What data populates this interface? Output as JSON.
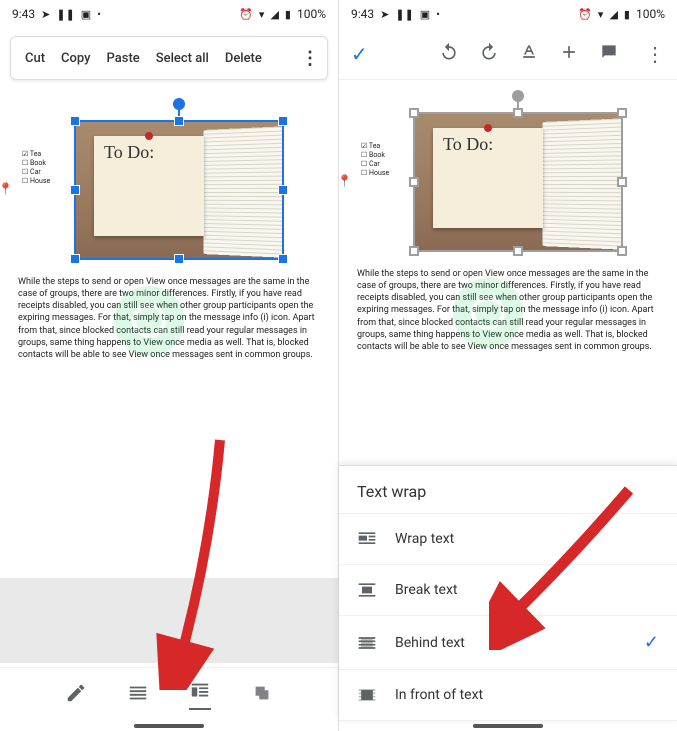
{
  "status": {
    "time": "9:43",
    "battery": "100%",
    "icons_left": [
      "send",
      "pause",
      "image",
      "dot"
    ],
    "icons_right": [
      "alarm",
      "wifi",
      "signal",
      "battery"
    ]
  },
  "context_menu": {
    "cut": "Cut",
    "copy": "Copy",
    "paste": "Paste",
    "select_all": "Select all",
    "delete": "Delete"
  },
  "toolbar": {
    "check": "✓"
  },
  "image_note": {
    "sticky_text": "To Do:",
    "checklist": [
      {
        "label": "Tea",
        "checked": true
      },
      {
        "label": "Book",
        "checked": false
      },
      {
        "label": "Car",
        "checked": false
      },
      {
        "label": "House",
        "checked": false
      }
    ]
  },
  "body_text": "While the steps to send or open View once messages are the same in the case of groups, there are two minor differences. Firstly, if you have read receipts disabled, you can still see when other group participants open the expiring messages. For that, simply tap on the message info (i) icon. Apart from that, since blocked contacts can still read your regular messages in groups, same thing happens to View once media as well. That is, blocked contacts will be able to see View once messages sent in common groups.",
  "bottom_toolbar": {
    "item_active_index": 2
  },
  "sheet": {
    "title": "Text wrap",
    "items": [
      {
        "key": "wrap",
        "label": "Wrap text",
        "selected": false
      },
      {
        "key": "break",
        "label": "Break text",
        "selected": false
      },
      {
        "key": "behind",
        "label": "Behind text",
        "selected": true
      },
      {
        "key": "front",
        "label": "In front of text",
        "selected": false
      }
    ]
  }
}
